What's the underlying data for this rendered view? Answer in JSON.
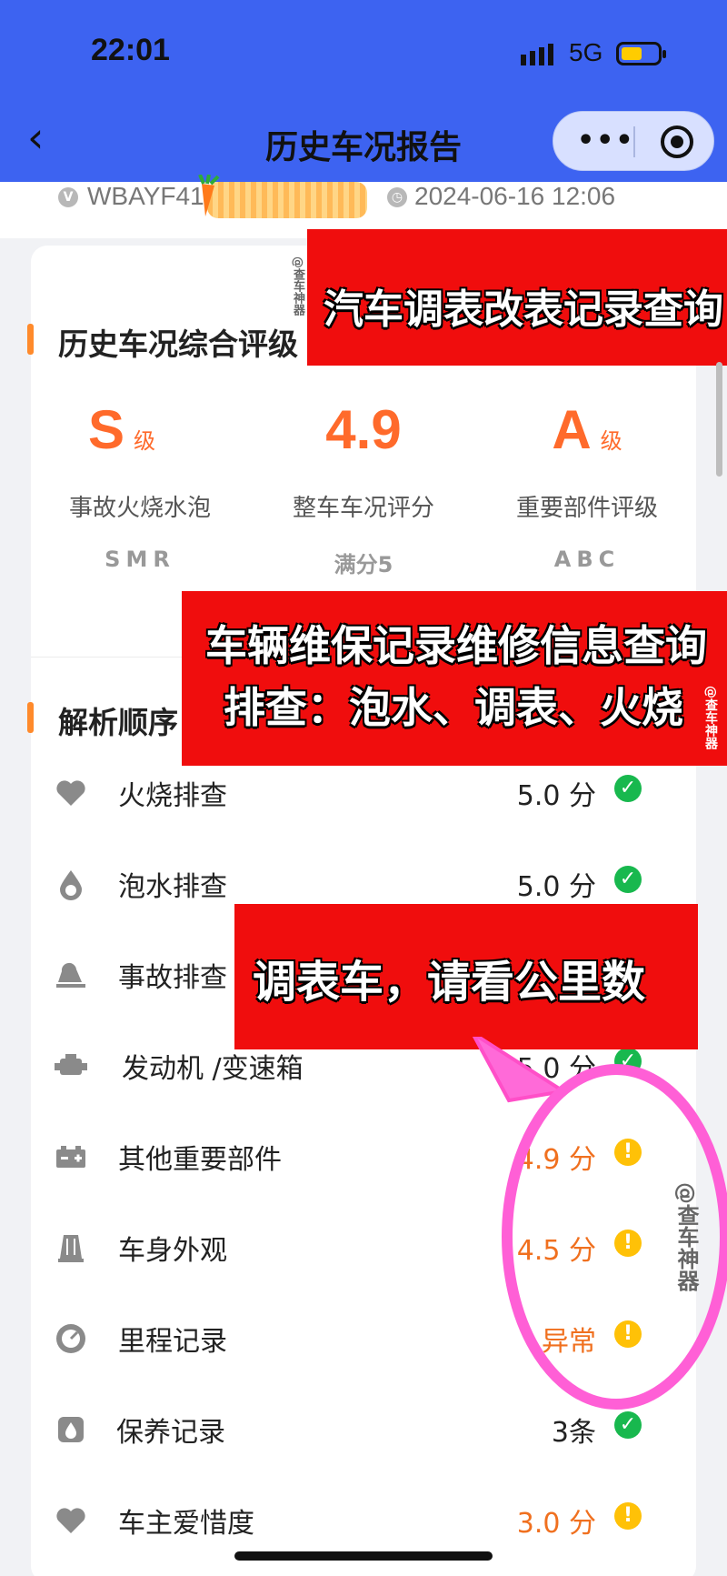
{
  "status_bar": {
    "time": "22:01",
    "network": "5G"
  },
  "nav": {
    "back_icon": "‹",
    "title": "历史车况报告",
    "more_icon": "•••"
  },
  "meta": {
    "vin_prefix": "WBAYF41",
    "datetime": "2024-06-16 12:06",
    "vin_icon": "V"
  },
  "overview": {
    "title": "历史车况综合评级",
    "grades": [
      {
        "value": "S",
        "unit": "级",
        "label": "事故火烧水泡",
        "scale": "SMR"
      },
      {
        "value": "4.9",
        "unit": "",
        "label": "整车车况评分",
        "scale": "满分5"
      },
      {
        "value": "A",
        "unit": "级",
        "label": "重要部件评级",
        "scale": "ABC"
      }
    ]
  },
  "analysis": {
    "title": "解析顺序",
    "rows": [
      {
        "label": "火烧排查",
        "score": "5.0 分",
        "status": "ok",
        "icon": "heart-icon"
      },
      {
        "label": "泡水排查",
        "score": "5.0 分",
        "status": "ok",
        "icon": "water-drop-icon"
      },
      {
        "label": "事故排查",
        "score": "",
        "status": "",
        "icon": "accident-car-icon"
      },
      {
        "label": "发动机 /变速箱",
        "score": "5.0 分",
        "status": "ok",
        "icon": "engine-icon"
      },
      {
        "label": "其他重要部件",
        "score": "4.9 分",
        "status": "warn",
        "icon": "battery-icon"
      },
      {
        "label": "车身外观",
        "score": "4.5 分",
        "status": "warn",
        "icon": "car-body-icon"
      },
      {
        "label": "里程记录",
        "score": "异常",
        "status": "warn",
        "icon": "odometer-icon"
      },
      {
        "label": "保养记录",
        "score": "3条",
        "status": "ok",
        "icon": "oil-drop-icon"
      },
      {
        "label": "车主爱惜度",
        "score": "3.0 分",
        "status": "warn",
        "icon": "heart-icon"
      }
    ]
  },
  "overlays": {
    "banner1": "汽车调表改表记录查询",
    "banner2_line1": "车辆维保记录维修信息查询",
    "banner2_line2": "排查：泡水、调表、火烧",
    "banner3": "调表车，请看公里数",
    "watermark": "@查车神器"
  },
  "colors": {
    "header": "#3d63f1",
    "accent": "#ff6a2b",
    "ok": "#18b84e",
    "warn": "#ffc107",
    "banner": "#f00d0d",
    "highlight_ring": "#ff5fd6"
  }
}
